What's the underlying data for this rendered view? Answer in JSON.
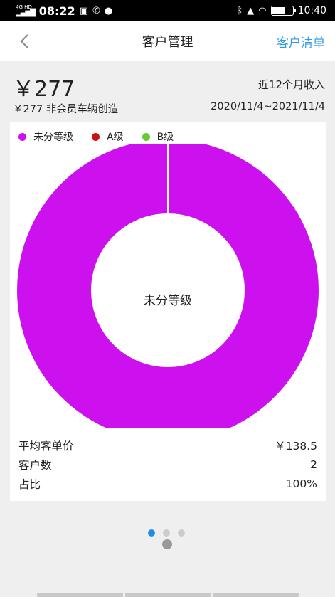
{
  "status_bar": {
    "network": "4G HD",
    "time": "08:22",
    "battery_text": "",
    "clock_right": "10:40"
  },
  "nav": {
    "title": "客户管理",
    "right_action": "客户清单"
  },
  "summary": {
    "amount": "￥277",
    "period_label": "近12个月收入",
    "sub_text": "￥277 非会员车辆创造",
    "date_range": "2020/11/4~2021/11/4"
  },
  "legend": [
    {
      "label": "未分等级",
      "color": "#cc11ee"
    },
    {
      "label": "A级",
      "color": "#cc1111"
    },
    {
      "label": "B级",
      "color": "#66cc33"
    }
  ],
  "chart_data": {
    "type": "pie",
    "categories": [
      "未分等级",
      "A级",
      "B级"
    ],
    "values": [
      100,
      0,
      0
    ],
    "colors": [
      "#cc11ee",
      "#cc1111",
      "#66cc33"
    ],
    "donut": true,
    "center_label": "未分等级"
  },
  "stats": [
    {
      "label": "平均客单价",
      "value": "￥138.5"
    },
    {
      "label": "客户数",
      "value": "2"
    },
    {
      "label": "占比",
      "value": "100%"
    }
  ],
  "pager": {
    "page_count": 3,
    "active_index": 0
  }
}
